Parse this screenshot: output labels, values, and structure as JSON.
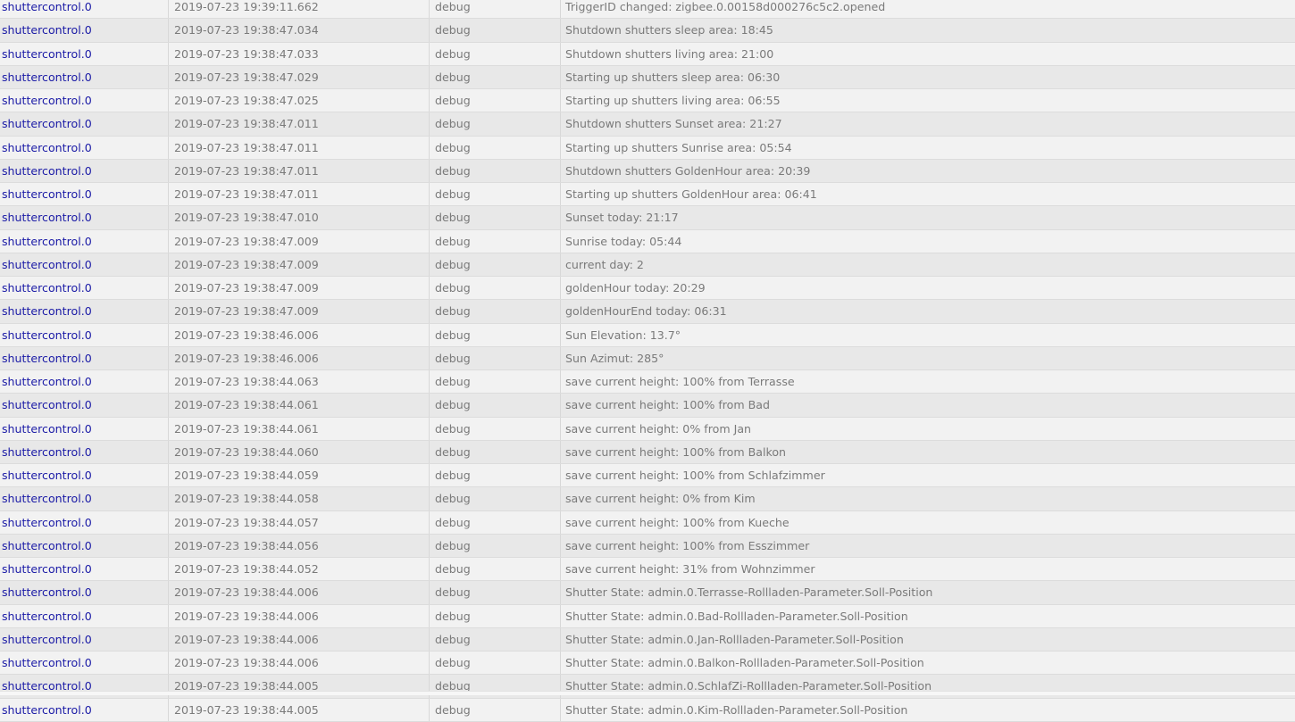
{
  "log": {
    "rows": [
      {
        "source": "shuttercontrol.0",
        "time": "2019-07-23 19:39:11.662",
        "severity": "debug",
        "message": "TriggerID changed: zigbee.0.00158d000276c5c2.opened"
      },
      {
        "source": "shuttercontrol.0",
        "time": "2019-07-23 19:38:47.034",
        "severity": "debug",
        "message": "Shutdown shutters sleep area: 18:45"
      },
      {
        "source": "shuttercontrol.0",
        "time": "2019-07-23 19:38:47.033",
        "severity": "debug",
        "message": "Shutdown shutters living area: 21:00"
      },
      {
        "source": "shuttercontrol.0",
        "time": "2019-07-23 19:38:47.029",
        "severity": "debug",
        "message": "Starting up shutters sleep area: 06:30"
      },
      {
        "source": "shuttercontrol.0",
        "time": "2019-07-23 19:38:47.025",
        "severity": "debug",
        "message": "Starting up shutters living area: 06:55"
      },
      {
        "source": "shuttercontrol.0",
        "time": "2019-07-23 19:38:47.011",
        "severity": "debug",
        "message": "Shutdown shutters Sunset area: 21:27"
      },
      {
        "source": "shuttercontrol.0",
        "time": "2019-07-23 19:38:47.011",
        "severity": "debug",
        "message": "Starting up shutters Sunrise area: 05:54"
      },
      {
        "source": "shuttercontrol.0",
        "time": "2019-07-23 19:38:47.011",
        "severity": "debug",
        "message": "Shutdown shutters GoldenHour area: 20:39"
      },
      {
        "source": "shuttercontrol.0",
        "time": "2019-07-23 19:38:47.011",
        "severity": "debug",
        "message": "Starting up shutters GoldenHour area: 06:41"
      },
      {
        "source": "shuttercontrol.0",
        "time": "2019-07-23 19:38:47.010",
        "severity": "debug",
        "message": "Sunset today: 21:17"
      },
      {
        "source": "shuttercontrol.0",
        "time": "2019-07-23 19:38:47.009",
        "severity": "debug",
        "message": "Sunrise today: 05:44"
      },
      {
        "source": "shuttercontrol.0",
        "time": "2019-07-23 19:38:47.009",
        "severity": "debug",
        "message": "current day: 2"
      },
      {
        "source": "shuttercontrol.0",
        "time": "2019-07-23 19:38:47.009",
        "severity": "debug",
        "message": "goldenHour today: 20:29"
      },
      {
        "source": "shuttercontrol.0",
        "time": "2019-07-23 19:38:47.009",
        "severity": "debug",
        "message": "goldenHourEnd today: 06:31"
      },
      {
        "source": "shuttercontrol.0",
        "time": "2019-07-23 19:38:46.006",
        "severity": "debug",
        "message": "Sun Elevation: 13.7°"
      },
      {
        "source": "shuttercontrol.0",
        "time": "2019-07-23 19:38:46.006",
        "severity": "debug",
        "message": "Sun Azimut: 285°"
      },
      {
        "source": "shuttercontrol.0",
        "time": "2019-07-23 19:38:44.063",
        "severity": "debug",
        "message": "save current height: 100% from Terrasse"
      },
      {
        "source": "shuttercontrol.0",
        "time": "2019-07-23 19:38:44.061",
        "severity": "debug",
        "message": "save current height: 100% from Bad"
      },
      {
        "source": "shuttercontrol.0",
        "time": "2019-07-23 19:38:44.061",
        "severity": "debug",
        "message": "save current height: 0% from Jan"
      },
      {
        "source": "shuttercontrol.0",
        "time": "2019-07-23 19:38:44.060",
        "severity": "debug",
        "message": "save current height: 100% from Balkon"
      },
      {
        "source": "shuttercontrol.0",
        "time": "2019-07-23 19:38:44.059",
        "severity": "debug",
        "message": "save current height: 100% from Schlafzimmer"
      },
      {
        "source": "shuttercontrol.0",
        "time": "2019-07-23 19:38:44.058",
        "severity": "debug",
        "message": "save current height: 0% from Kim"
      },
      {
        "source": "shuttercontrol.0",
        "time": "2019-07-23 19:38:44.057",
        "severity": "debug",
        "message": "save current height: 100% from Kueche"
      },
      {
        "source": "shuttercontrol.0",
        "time": "2019-07-23 19:38:44.056",
        "severity": "debug",
        "message": "save current height: 100% from Esszimmer"
      },
      {
        "source": "shuttercontrol.0",
        "time": "2019-07-23 19:38:44.052",
        "severity": "debug",
        "message": "save current height: 31% from Wohnzimmer"
      },
      {
        "source": "shuttercontrol.0",
        "time": "2019-07-23 19:38:44.006",
        "severity": "debug",
        "message": "Shutter State: admin.0.Terrasse-Rollladen-Parameter.Soll-Position"
      },
      {
        "source": "shuttercontrol.0",
        "time": "2019-07-23 19:38:44.006",
        "severity": "debug",
        "message": "Shutter State: admin.0.Bad-Rollladen-Parameter.Soll-Position"
      },
      {
        "source": "shuttercontrol.0",
        "time": "2019-07-23 19:38:44.006",
        "severity": "debug",
        "message": "Shutter State: admin.0.Jan-Rollladen-Parameter.Soll-Position"
      },
      {
        "source": "shuttercontrol.0",
        "time": "2019-07-23 19:38:44.006",
        "severity": "debug",
        "message": "Shutter State: admin.0.Balkon-Rollladen-Parameter.Soll-Position"
      },
      {
        "source": "shuttercontrol.0",
        "time": "2019-07-23 19:38:44.005",
        "severity": "debug",
        "message": "Shutter State: admin.0.SchlafZi-Rollladen-Parameter.Soll-Position"
      },
      {
        "source": "shuttercontrol.0",
        "time": "2019-07-23 19:38:44.005",
        "severity": "debug",
        "message": "Shutter State: admin.0.Kim-Rollladen-Parameter.Soll-Position"
      }
    ]
  }
}
